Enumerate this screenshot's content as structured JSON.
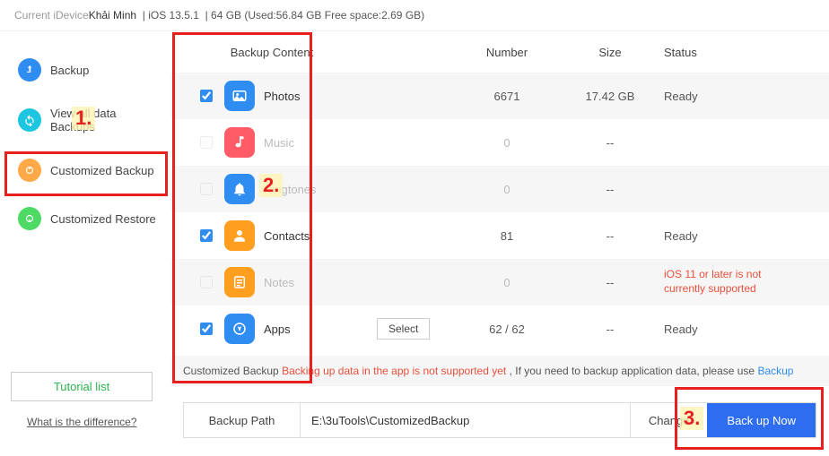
{
  "header": {
    "device_label": "Current iDevice",
    "device_name": "Khải Minh",
    "ios": "iOS 13.5.1",
    "storage": "64 GB (Used:56.84 GB Free space:2.69 GB)"
  },
  "sidebar": {
    "items": [
      {
        "label": "Backup"
      },
      {
        "label": "View all data Backups"
      },
      {
        "label": "Customized Backup"
      },
      {
        "label": "Customized Restore"
      }
    ],
    "tutorial": "Tutorial list",
    "diff": "What is the difference?"
  },
  "table": {
    "head": {
      "content": "Backup Content",
      "number": "Number",
      "size": "Size",
      "status": "Status"
    },
    "rows": [
      {
        "name": "Photos",
        "checked": true,
        "disabled": false,
        "number": "6671",
        "size": "17.42 GB",
        "status": "Ready"
      },
      {
        "name": "Music",
        "checked": false,
        "disabled": true,
        "number": "0",
        "size": "--",
        "status": ""
      },
      {
        "name": "Ringtones",
        "checked": false,
        "disabled": true,
        "number": "0",
        "size": "--",
        "status": ""
      },
      {
        "name": "Contacts",
        "checked": true,
        "disabled": false,
        "number": "81",
        "size": "--",
        "status": "Ready"
      },
      {
        "name": "Notes",
        "checked": false,
        "disabled": true,
        "number": "0",
        "size": "--",
        "status": "iOS 11 or later is not currently supported",
        "error": true
      },
      {
        "name": "Apps",
        "checked": true,
        "disabled": false,
        "number": "62 / 62",
        "size": "--",
        "status": "Ready",
        "select": "Select"
      }
    ]
  },
  "notice": {
    "prefix": "Customized Backup ",
    "red": "Backing up data in the app is not supported yet",
    "mid": " , If you need to backup application data, please use ",
    "link": "Backup"
  },
  "path": {
    "label": "Backup Path",
    "value": "E:\\3uTools\\CustomizedBackup",
    "change": "Change",
    "backup_now": "Back up Now"
  },
  "annotations": {
    "n1": "1.",
    "n2": "2.",
    "n3": "3."
  }
}
